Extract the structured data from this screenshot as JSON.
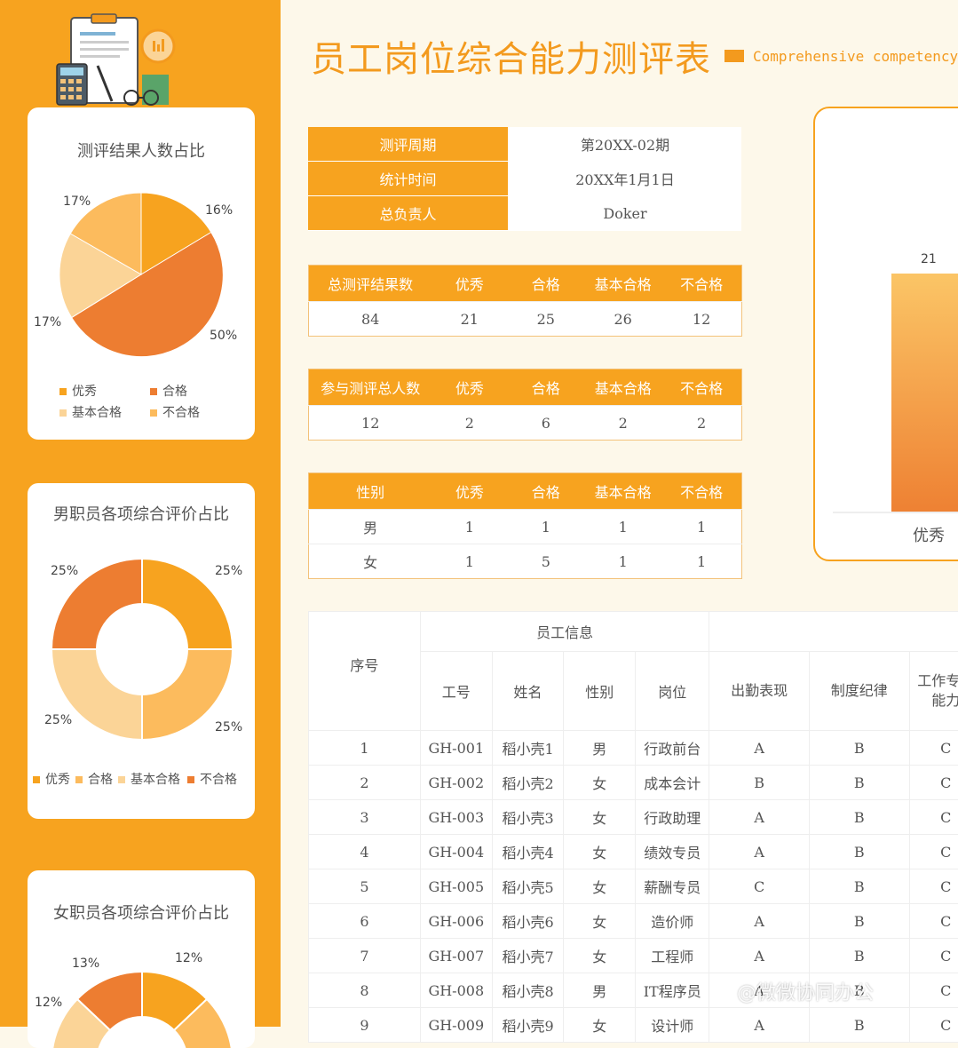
{
  "header": {
    "title": "员工岗位综合能力测评表",
    "subtitle": "Comprehensive competency"
  },
  "pie1": {
    "title": "测评结果人数占比",
    "labels": [
      "16%",
      "50%",
      "17%",
      "17%"
    ],
    "legend": [
      "优秀",
      "合格",
      "基本合格",
      "不合格"
    ]
  },
  "donut_male": {
    "title": "男职员各项综合评价占比",
    "labels": [
      "25%",
      "25%",
      "25%",
      "25%"
    ],
    "legend": [
      "优秀",
      "合格",
      "基本合格",
      "不合格"
    ]
  },
  "donut_female": {
    "title": "女职员各项综合评价占比",
    "labels": [
      "12%",
      "13%",
      "12%"
    ]
  },
  "info": {
    "rows": [
      {
        "k": "测评周期",
        "v": "第20XX-02期"
      },
      {
        "k": "统计时间",
        "v": "20XX年1月1日"
      },
      {
        "k": "总负责人",
        "v": "Doker"
      }
    ]
  },
  "summary1": {
    "headers": [
      "总测评结果数",
      "优秀",
      "合格",
      "基本合格",
      "不合格"
    ],
    "values": [
      "84",
      "21",
      "25",
      "26",
      "12"
    ]
  },
  "summary2": {
    "headers": [
      "参与测评总人数",
      "优秀",
      "合格",
      "基本合格",
      "不合格"
    ],
    "values": [
      "12",
      "2",
      "6",
      "2",
      "2"
    ]
  },
  "gender": {
    "headers": [
      "性别",
      "优秀",
      "合格",
      "基本合格",
      "不合格"
    ],
    "rows": [
      [
        "男",
        "1",
        "1",
        "1",
        "1"
      ],
      [
        "女",
        "1",
        "5",
        "1",
        "1"
      ]
    ]
  },
  "bar_chart": {
    "value_label": "21",
    "category": "优秀"
  },
  "employees": {
    "group_header": "员工信息",
    "seq_header": "序号",
    "col_headers": [
      "工号",
      "姓名",
      "性别",
      "岗位",
      "出勤表现",
      "制度纪律",
      "工作专业能力"
    ],
    "rows": [
      [
        "1",
        "GH-001",
        "稻小壳1",
        "男",
        "行政前台",
        "A",
        "B",
        "C"
      ],
      [
        "2",
        "GH-002",
        "稻小壳2",
        "女",
        "成本会计",
        "B",
        "B",
        "C"
      ],
      [
        "3",
        "GH-003",
        "稻小壳3",
        "女",
        "行政助理",
        "A",
        "B",
        "C"
      ],
      [
        "4",
        "GH-004",
        "稻小壳4",
        "女",
        "绩效专员",
        "A",
        "B",
        "C"
      ],
      [
        "5",
        "GH-005",
        "稻小壳5",
        "女",
        "薪酬专员",
        "C",
        "B",
        "C"
      ],
      [
        "6",
        "GH-006",
        "稻小壳6",
        "女",
        "造价师",
        "A",
        "B",
        "C"
      ],
      [
        "7",
        "GH-007",
        "稻小壳7",
        "女",
        "工程师",
        "A",
        "B",
        "C"
      ],
      [
        "8",
        "GH-008",
        "稻小壳8",
        "男",
        "IT程序员",
        "A",
        "B",
        "C"
      ],
      [
        "9",
        "GH-009",
        "稻小壳9",
        "女",
        "设计师",
        "A",
        "B",
        "C"
      ]
    ]
  },
  "watermark": "@微微协同办公",
  "colors": {
    "primary": "#f7a31f",
    "dark": "#ed7d31",
    "light": "#fbd497",
    "mid": "#fcbb5d"
  }
}
